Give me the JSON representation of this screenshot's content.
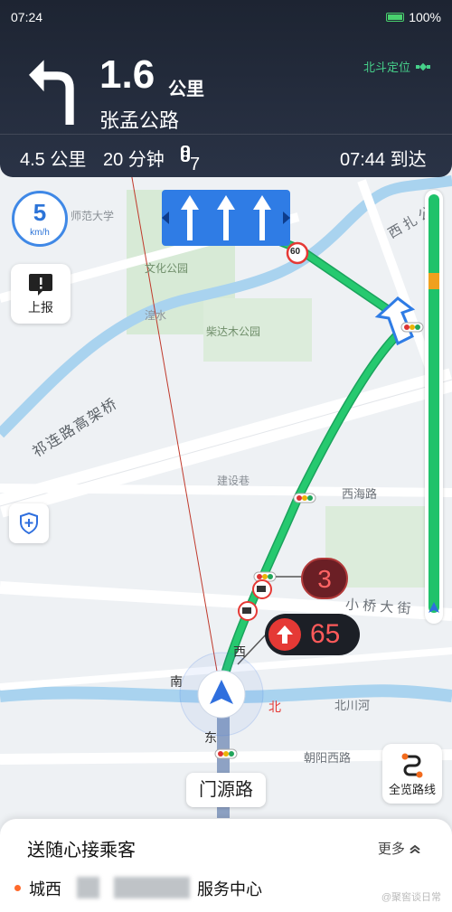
{
  "status": {
    "time": "07:24",
    "battery": "100%"
  },
  "guidance": {
    "distance_value": "1.6",
    "distance_unit": "公里",
    "road": "张孟公路",
    "beidou": "北斗定位"
  },
  "trip": {
    "remaining_distance": "4.5 公里",
    "remaining_time": "20 分钟",
    "traffic_lights": "7",
    "eta": "07:44 到达"
  },
  "speed": {
    "value": "5",
    "unit": "km/h"
  },
  "buttons": {
    "report": "上报",
    "overview": "全览路线"
  },
  "map": {
    "labels": {
      "university": "师范大学",
      "park1": "文化公园",
      "park2": "柴达木公园",
      "water": "湟水",
      "lane": "建设巷",
      "viaduct": "祁连路高架桥",
      "road_xihai": "西海路",
      "road_xiaoqiao": "小 桥 大 街",
      "road_beichuan": "北川河",
      "road_chaoyangxi": "朝阳西路",
      "road_xizha": "西 扎 公",
      "dir_west": "西",
      "dir_south": "南",
      "dir_east": "东",
      "dir_north": "北",
      "limit_sign": "60"
    },
    "traffic_light_countdown": "3",
    "speed_limit": "65"
  },
  "current_road": "门源路",
  "panel": {
    "title": "送随心接乘客",
    "more": "更多",
    "address_prefix": "城西",
    "address_suffix": "服务中心",
    "watermark": "@聚窖谈日常"
  },
  "colors": {
    "route": "#1fc26a",
    "accent": "#2f7ce5",
    "topbar": "#1d2432"
  },
  "icons": [
    "turn-left-icon",
    "satellite-icon",
    "battery-icon",
    "report-icon",
    "shield-plus-icon",
    "overview-route-icon",
    "navigation-arrow-icon",
    "traffic-light-icon",
    "camera-icon",
    "up-arrow-icon",
    "chevron-up-icon"
  ]
}
